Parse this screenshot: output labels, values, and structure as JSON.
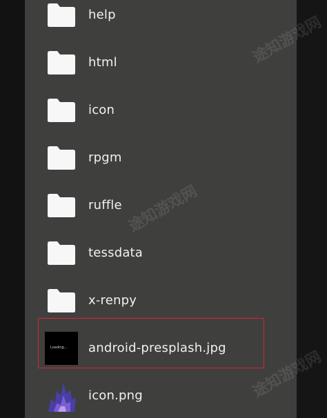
{
  "files": [
    {
      "name": "help",
      "type": "folder"
    },
    {
      "name": "html",
      "type": "folder"
    },
    {
      "name": "icon",
      "type": "folder"
    },
    {
      "name": "rpgm",
      "type": "folder"
    },
    {
      "name": "ruffle",
      "type": "folder"
    },
    {
      "name": "tessdata",
      "type": "folder"
    },
    {
      "name": "x-renpy",
      "type": "folder"
    },
    {
      "name": "android-presplash.jpg",
      "type": "image",
      "thumb_text": "Loading...",
      "selected": true
    },
    {
      "name": "icon.png",
      "type": "png"
    }
  ],
  "watermark": "途知游戏网",
  "colors": {
    "panel": "#3f3f3e",
    "selection_border": "#d9262d",
    "folder_icon": "#f7f7f7",
    "text": "#f1f1f1"
  }
}
